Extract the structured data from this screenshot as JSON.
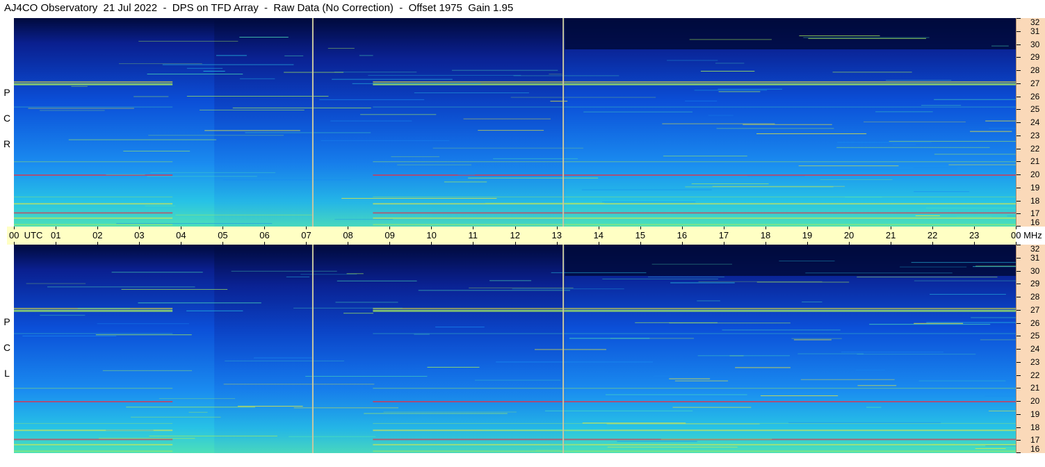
{
  "title": "AJ4CO Observatory  21 Jul 2022  -  DPS on TFD Array  -  Raw Data (No Correction)  -  Offset 1975  Gain 1.95",
  "chart_data": {
    "type": "heatmap",
    "title": "AJ4CO Observatory  21 Jul 2022  -  DPS on TFD Array  -  Raw Data (No Correction)  -  Offset 1975  Gain 1.95",
    "x_unit_label": "UTC",
    "y_unit_label": "MHz",
    "xlim": [
      0,
      24
    ],
    "ylim": [
      16,
      32
    ],
    "hour_ticks": [
      "00",
      "01",
      "02",
      "03",
      "04",
      "05",
      "06",
      "07",
      "08",
      "09",
      "10",
      "11",
      "12",
      "13",
      "14",
      "15",
      "16",
      "17",
      "18",
      "19",
      "20",
      "21",
      "22",
      "23",
      "00"
    ],
    "freq_ticks": [
      "32",
      "31",
      "30",
      "29",
      "28",
      "27",
      "26",
      "25",
      "24",
      "23",
      "22",
      "21",
      "20",
      "19",
      "18",
      "17",
      "16"
    ],
    "panels": [
      {
        "name": "RCP",
        "letters": [
          "R",
          "C",
          "P"
        ]
      },
      {
        "name": "LCP",
        "letters": [
          "L",
          "C",
          "P"
        ]
      }
    ],
    "markers_hour": [
      7.16,
      13.16
    ],
    "colormap": [
      "#000a3c",
      "#0a1f8f",
      "#0b4fd8",
      "#1a8cf0",
      "#27c2e6",
      "#4de0b8",
      "#a8ee5a",
      "#f5ee30",
      "#ff9a20",
      "#e0304a"
    ]
  }
}
